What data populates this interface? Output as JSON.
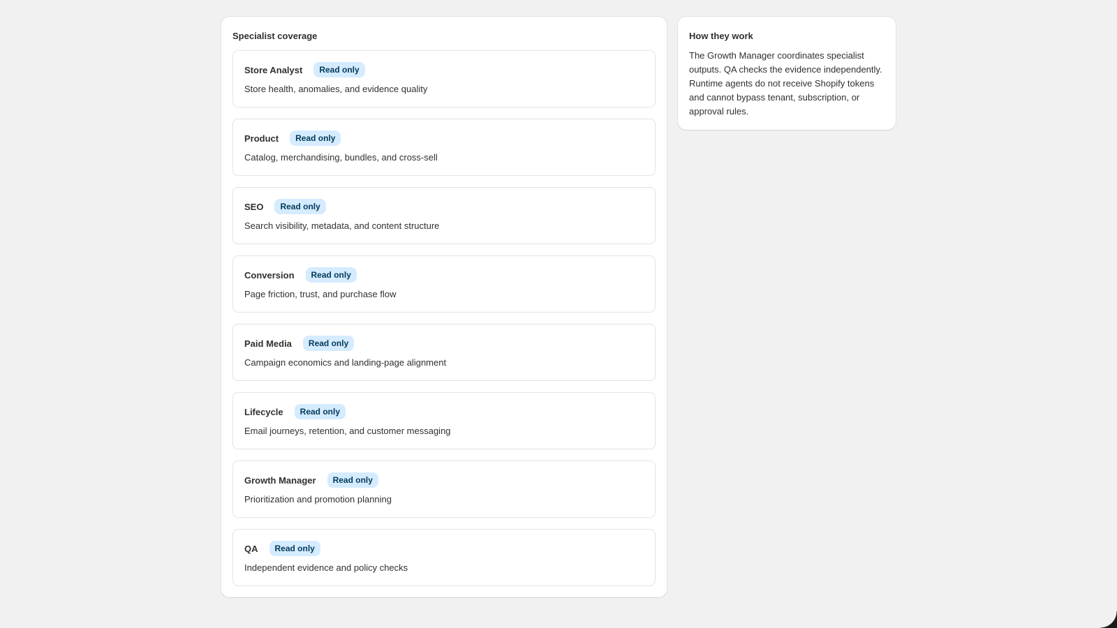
{
  "coverage": {
    "title": "Specialist coverage",
    "items": [
      {
        "name": "Store Analyst",
        "badge": "Read only",
        "description": "Store health, anomalies, and evidence quality"
      },
      {
        "name": "Product",
        "badge": "Read only",
        "description": "Catalog, merchandising, bundles, and cross-sell"
      },
      {
        "name": "SEO",
        "badge": "Read only",
        "description": "Search visibility, metadata, and content structure"
      },
      {
        "name": "Conversion",
        "badge": "Read only",
        "description": "Page friction, trust, and purchase flow"
      },
      {
        "name": "Paid Media",
        "badge": "Read only",
        "description": "Campaign economics and landing-page alignment"
      },
      {
        "name": "Lifecycle",
        "badge": "Read only",
        "description": "Email journeys, retention, and customer messaging"
      },
      {
        "name": "Growth Manager",
        "badge": "Read only",
        "description": "Prioritization and promotion planning"
      },
      {
        "name": "QA",
        "badge": "Read only",
        "description": "Independent evidence and policy checks"
      }
    ]
  },
  "how_they_work": {
    "title": "How they work",
    "body": "The Growth Manager coordinates specialist outputs. QA checks the evidence independently. Runtime agents do not receive Shopify tokens and cannot bypass tenant, subscription, or approval rules."
  },
  "colors": {
    "background": "#f1f1f1",
    "card": "#ffffff",
    "badge_bg": "#d5ebff",
    "badge_text": "#003a5a"
  }
}
